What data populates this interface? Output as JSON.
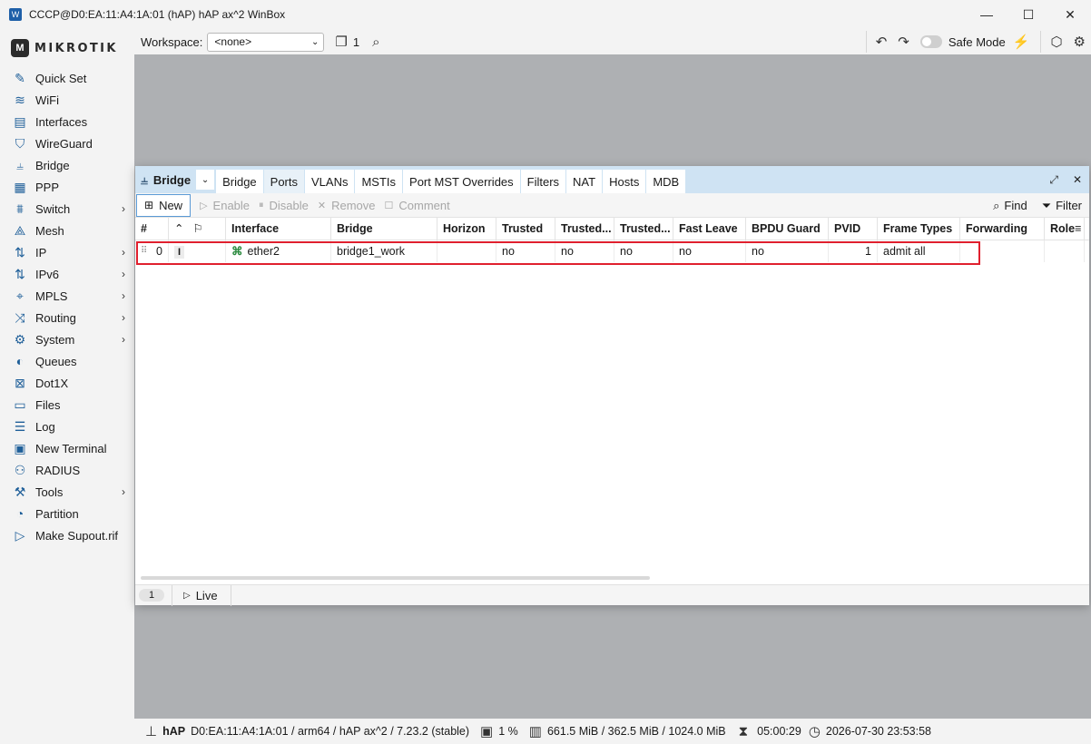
{
  "window": {
    "title": "CCCP@D0:EA:11:A4:1A:01 (hAP) hAP ax^2 WinBox",
    "minimize": "—",
    "maximize": "☐",
    "close": "✕"
  },
  "brand": {
    "logo_text": "MIKROTIK"
  },
  "sidebar": {
    "items": [
      {
        "label": "Quick Set",
        "icon": "wand-icon",
        "glyph": "✎",
        "submenu": false
      },
      {
        "label": "WiFi",
        "icon": "wifi-icon",
        "glyph": "≋",
        "submenu": false
      },
      {
        "label": "Interfaces",
        "icon": "interfaces-icon",
        "glyph": "▤",
        "submenu": false
      },
      {
        "label": "WireGuard",
        "icon": "wireguard-icon",
        "glyph": "⛉",
        "submenu": false
      },
      {
        "label": "Bridge",
        "icon": "bridge-icon",
        "glyph": "⫨",
        "submenu": false
      },
      {
        "label": "PPP",
        "icon": "ppp-icon",
        "glyph": "▦",
        "submenu": false
      },
      {
        "label": "Switch",
        "icon": "switch-icon",
        "glyph": "⩩",
        "submenu": true
      },
      {
        "label": "Mesh",
        "icon": "mesh-icon",
        "glyph": "⟁",
        "submenu": false
      },
      {
        "label": "IP",
        "icon": "ip-icon",
        "glyph": "⇅",
        "submenu": true
      },
      {
        "label": "IPv6",
        "icon": "ipv6-icon",
        "glyph": "⇅",
        "submenu": true
      },
      {
        "label": "MPLS",
        "icon": "mpls-icon",
        "glyph": "⌖",
        "submenu": true
      },
      {
        "label": "Routing",
        "icon": "routing-icon",
        "glyph": "⤨",
        "submenu": true
      },
      {
        "label": "System",
        "icon": "system-icon",
        "glyph": "⚙",
        "submenu": true
      },
      {
        "label": "Queues",
        "icon": "queues-icon",
        "glyph": "◐",
        "submenu": false
      },
      {
        "label": "Dot1X",
        "icon": "dot1x-icon",
        "glyph": "⊠",
        "submenu": false
      },
      {
        "label": "Files",
        "icon": "files-icon",
        "glyph": "▭",
        "submenu": false
      },
      {
        "label": "Log",
        "icon": "log-icon",
        "glyph": "☰",
        "submenu": false
      },
      {
        "label": "New Terminal",
        "icon": "terminal-icon",
        "glyph": "▣",
        "submenu": false
      },
      {
        "label": "RADIUS",
        "icon": "radius-icon",
        "glyph": "⚇",
        "submenu": false
      },
      {
        "label": "Tools",
        "icon": "tools-icon",
        "glyph": "⚒",
        "submenu": true
      },
      {
        "label": "Partition",
        "icon": "partition-icon",
        "glyph": "◔",
        "submenu": false
      },
      {
        "label": "Make Supout.rif",
        "icon": "supout-icon",
        "glyph": "▷",
        "submenu": false
      }
    ]
  },
  "toolbar": {
    "workspace_label": "Workspace:",
    "workspace_value": "<none>",
    "windows_count": "1",
    "safe_mode_label": "Safe Mode"
  },
  "bridge_window": {
    "title": "Bridge",
    "tabs": [
      "Bridge",
      "Ports",
      "VLANs",
      "MSTIs",
      "Port MST Overrides",
      "Filters",
      "NAT",
      "Hosts",
      "MDB"
    ],
    "active_tab": "Ports",
    "actions": {
      "new": "New",
      "enable": "Enable",
      "disable": "Disable",
      "remove": "Remove",
      "comment": "Comment",
      "find": "Find",
      "filter": "Filter"
    },
    "columns": [
      "#",
      "",
      "Interface",
      "Bridge",
      "Horizon",
      "Trusted",
      "Trusted...",
      "Trusted...",
      "Fast Leave",
      "BPDU Guard",
      "PVID",
      "Frame Types",
      "Forwarding",
      "Role"
    ],
    "rows": [
      {
        "index": "0",
        "flag": "I",
        "interface": "ether2",
        "bridge": "bridge1_work",
        "horizon": "",
        "trusted": "no",
        "trusted2": "no",
        "trusted3": "no",
        "fast_leave": "no",
        "bpdu_guard": "no",
        "pvid": "1",
        "frame_types": "admit all",
        "forwarding": "",
        "role": ""
      }
    ],
    "footer": {
      "count": "1",
      "live": "Live"
    }
  },
  "statusbar": {
    "device": "hAP",
    "details": "D0:EA:11:A4:1A:01 / arm64 / hAP ax^2 / 7.23.2 (stable)",
    "cpu": "1 %",
    "memory": "661.5 MiB / 362.5 MiB / 1024.0 MiB",
    "uptime": "05:00:29",
    "datetime": "2026-07-30 23:53:58"
  }
}
